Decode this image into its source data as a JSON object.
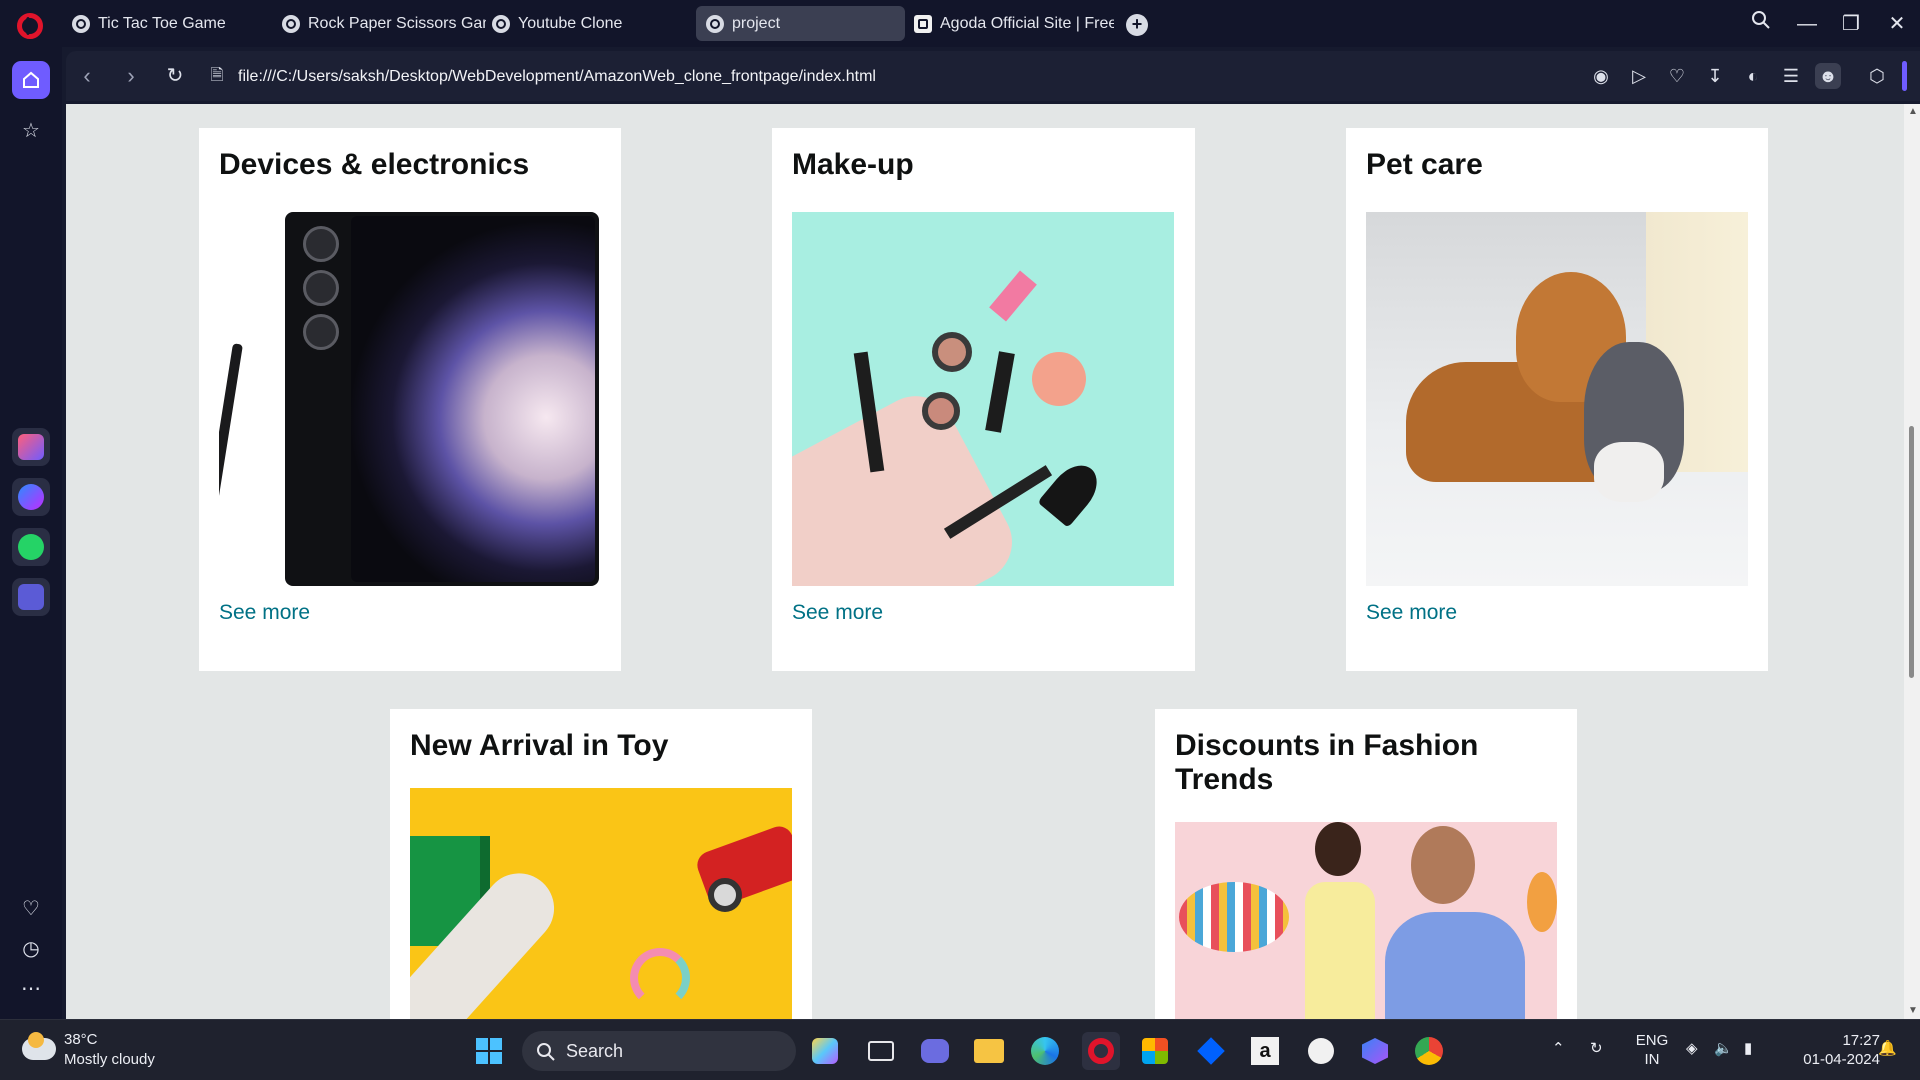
{
  "browser": {
    "tabs": [
      {
        "title": "Tic Tac Toe Game",
        "active": false
      },
      {
        "title": "Rock Paper Scissors Game",
        "active": false
      },
      {
        "title": "Youtube Clone",
        "active": false
      },
      {
        "title": "project",
        "active": true
      },
      {
        "title": "Agoda Official Site | Free C",
        "active": false
      }
    ],
    "url": "file:///C:/Users/saksh/Desktop/WebDevelopment/AmazonWeb_clone_frontpage/index.html",
    "accent": "#6f5cff"
  },
  "page": {
    "cards": [
      {
        "title": "Devices & electronics",
        "link": "See more",
        "image": "phone"
      },
      {
        "title": "Make-up",
        "link": "See more",
        "image": "makeup"
      },
      {
        "title": "Pet care",
        "link": "See more",
        "image": "pets"
      },
      {
        "title": "New Arrival in Toy",
        "link": "",
        "image": "toys"
      },
      {
        "title": "Discounts in Fashion Trends",
        "link": "",
        "image": "fashion"
      }
    ],
    "link_color": "#007185"
  },
  "taskbar": {
    "weather": {
      "temp": "38°C",
      "condition": "Mostly cloudy"
    },
    "search_label": "Search",
    "language": {
      "line1": "ENG",
      "line2": "IN"
    },
    "clock": {
      "time": "17:27",
      "date": "01-04-2024"
    }
  }
}
